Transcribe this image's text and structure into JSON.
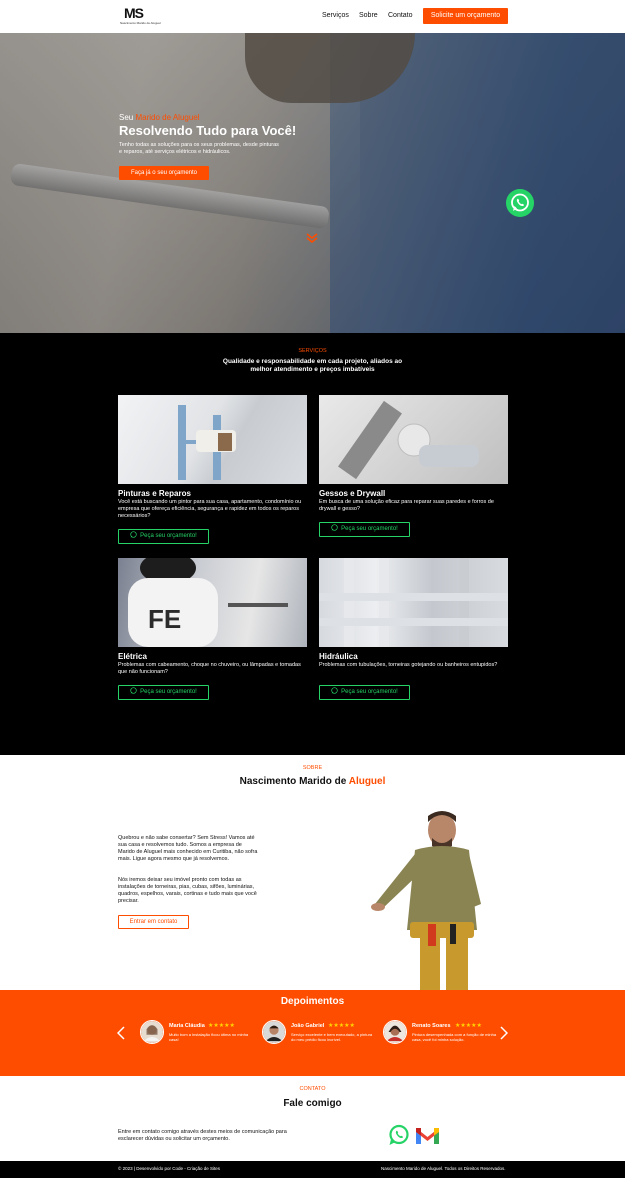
{
  "header": {
    "logo_mark": "MS",
    "logo_sub": "Nascimento Marido de Aluguel",
    "nav": [
      "Serviços",
      "Sobre",
      "Contato"
    ],
    "cta": "Solicite um orçamento"
  },
  "hero": {
    "pre_text": "Seu ",
    "pre_accent": "Marido de Aluguel",
    "title": "Resolvendo Tudo para Você!",
    "text": "Tenho todas as soluções para os seus problemas, desde pinturas e reparos, até serviços elétricos e hidráulicos.",
    "button": "Faça já o seu orçamento"
  },
  "services": {
    "eyebrow": "SERVIÇOS",
    "heading": "Qualidade e responsabilidade em cada projeto, aliados ao melhor atendimento e preços imbatíveis",
    "cards": [
      {
        "title": "Pinturas e Reparos",
        "desc": "Você está buscando um pintor para sua casa, apartamento, condomínio ou empresa que ofereça eficiência, segurança e rapidez em todos os reparos necessários?",
        "button": "Peça seu orçamento!"
      },
      {
        "title": "Gessos e Drywall",
        "desc": "Em busca de uma solução eficaz para reparar suas paredes e forros de drywall e gesso?",
        "button": "Peça seu orçamento!"
      },
      {
        "title": "Elétrica",
        "desc": "Problemas com cabeamento, choque no chuveiro, ou lâmpadas e tomadas que não funcionam?",
        "button": "Peça seu orçamento!"
      },
      {
        "title": "Hidráulica",
        "desc": "Problemas com tubulações, torneiras gotejando ou banheiros entupidos?",
        "button": "Peça seu orçamento!"
      }
    ]
  },
  "about": {
    "eyebrow": "SOBRE",
    "title": "Nascimento Marido de ",
    "title_accent": "Aluguel",
    "p1": "Quebrou e não sabe consertar? Sem Stress! Vamos até sua casa e resolvemos tudo. Somos a empresa de Marido de Aluguel mais conhecido em Curitiba, não sofra mais. Ligue agora mesmo que já resolvemos.",
    "p2": "Nós iremos deixar seu imóvel pronto com todas as instalações de torneiras, pias, cubas, sifões, luminárias, quadros, espelhos, varais, cortinas e tudo mais que você precisar.",
    "button": "Entrar em contato"
  },
  "testimonials": {
    "title": "Depoimentos",
    "items": [
      {
        "name": "Maria Cláudia",
        "stars": "★★★★★",
        "quote": "Muito bom a instalação ficou ótima no minha casa!"
      },
      {
        "name": "João Gabriel",
        "stars": "★★★★★",
        "quote": "Serviço excelente e bem executado, a pintura do meu prédio ficou incrível."
      },
      {
        "name": "Renato Soares",
        "stars": "★★★★★",
        "quote": "Pintura desempenhada com a função de minha casa, você foi minha solução."
      }
    ]
  },
  "contact": {
    "eyebrow": "CONTATO",
    "title": "Fale comigo",
    "text": "Entre em contato comigo através destes meios de comunicação para esclarecer dúvidas ou solicitar um orçamento."
  },
  "footer": {
    "left": "© 2023 | Desenvolvido por Code - Criação de Sites",
    "right": "Nascimento Marido de Aluguel. Todos os Direitos Reservados."
  },
  "colors": {
    "accent": "#ff4d00",
    "whatsapp": "#25d366",
    "dark": "#000000"
  }
}
